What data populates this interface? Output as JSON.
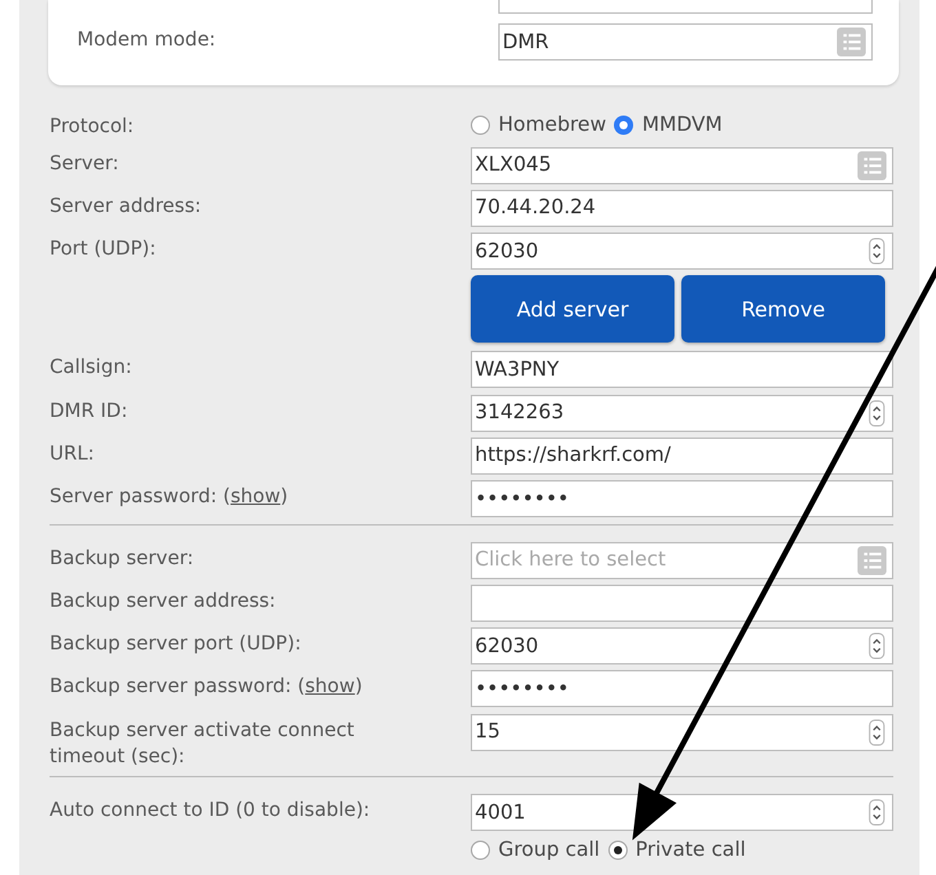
{
  "card": {
    "rows": [
      {
        "kind": "text",
        "cut": true
      },
      {
        "kind": "select",
        "label": "Modem mode:",
        "value": "DMR"
      }
    ]
  },
  "sections": [
    {
      "rows": [
        {
          "kind": "radio",
          "label": "Protocol:",
          "focused": true,
          "options": [
            {
              "label": "Homebrew",
              "selected": false
            },
            {
              "label": "MMDVM",
              "selected": true
            }
          ]
        },
        {
          "kind": "select",
          "label": "Server:",
          "value": "XLX045"
        },
        {
          "kind": "text",
          "label": "Server address:",
          "value": "70.44.20.24"
        },
        {
          "kind": "number",
          "label": "Port (UDP):",
          "value": "62030"
        },
        {
          "kind": "buttons",
          "buttons": [
            "Add server",
            "Remove"
          ]
        },
        {
          "kind": "text",
          "label": "Callsign:",
          "value": "WA3PNY"
        },
        {
          "kind": "number",
          "label": "DMR ID:",
          "value": "3142263"
        },
        {
          "kind": "text",
          "label": "URL:",
          "value": "https://sharkrf.com/"
        },
        {
          "kind": "text",
          "label": "Server password:",
          "link_before": " (",
          "link": "show",
          "link_after": ")",
          "value": "••••••••"
        }
      ]
    },
    {
      "rows": [
        {
          "kind": "select",
          "label": "Backup server:",
          "placeholder": "Click here to select"
        },
        {
          "kind": "text",
          "label": "Backup server address:"
        },
        {
          "kind": "number",
          "label": "Backup server port (UDP):",
          "value": "62030"
        },
        {
          "kind": "text",
          "label": "Backup server password:",
          "link_before": " (",
          "link": "show",
          "link_after": ")",
          "value": "••••••••"
        },
        {
          "kind": "number",
          "label": "Backup server activate connect timeout (sec):",
          "value": "15"
        }
      ]
    },
    {
      "rows": [
        {
          "kind": "number",
          "label": "Auto connect to ID (0 to disable):",
          "value": "4001"
        },
        {
          "kind": "radio",
          "focused": false,
          "options": [
            {
              "label": "Group call",
              "selected": false
            },
            {
              "label": "Private call",
              "selected": true
            }
          ]
        }
      ]
    }
  ]
}
